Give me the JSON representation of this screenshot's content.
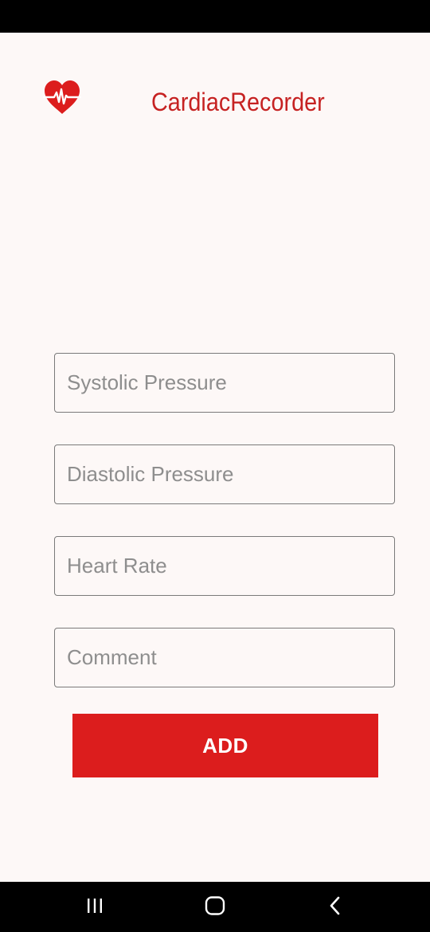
{
  "app": {
    "title": "CardiacRecorder",
    "logo_icon": "heart-pulse-icon",
    "accent_color": "#dc1d1d",
    "title_color": "#c62222"
  },
  "form": {
    "fields": [
      {
        "placeholder": "Systolic Pressure",
        "value": ""
      },
      {
        "placeholder": "Diastolic Pressure",
        "value": ""
      },
      {
        "placeholder": "Heart Rate",
        "value": ""
      },
      {
        "placeholder": "Comment",
        "value": ""
      }
    ],
    "add_label": "ADD"
  },
  "nav": {
    "recents_icon": "recents-icon",
    "home_icon": "home-icon",
    "back_icon": "back-icon"
  }
}
